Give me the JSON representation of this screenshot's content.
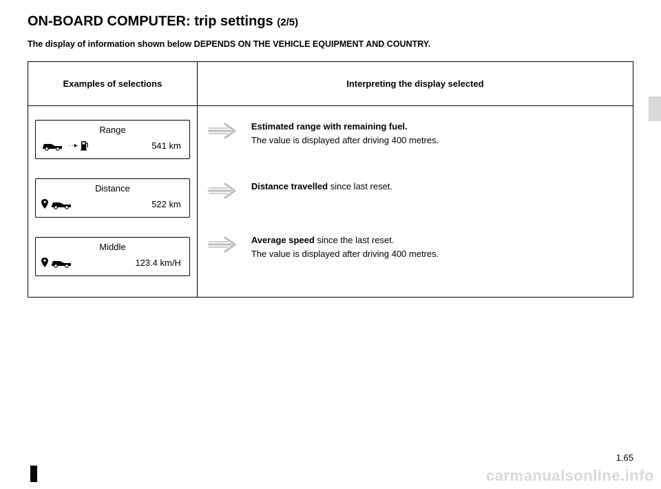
{
  "title": {
    "main": "ON-BOARD COMPUTER: trip settings",
    "suffix": "(2/5)"
  },
  "subtext": "The display of information shown below DEPENDS ON THE VEHICLE EQUIPMENT AND COUNTRY.",
  "headers": {
    "col1": "Examples of selections",
    "col2": "Interpreting the display selected"
  },
  "rows": [
    {
      "label": "Range",
      "value": "541 km",
      "interp_bold": "Estimated range with remaining fuel.",
      "interp_rest": "",
      "interp_line2": "The value is displayed after driving 400 metres.",
      "icon_type": "car_fuel"
    },
    {
      "label": "Distance",
      "value": "522 km",
      "interp_bold": "Distance travelled",
      "interp_rest": " since last reset.",
      "interp_line2": "",
      "icon_type": "pin_car"
    },
    {
      "label": "Middle",
      "value": "123.4 km/H",
      "interp_bold": "Average speed",
      "interp_rest": " since the last reset.",
      "interp_line2": "The value is displayed after driving 400 metres.",
      "icon_type": "pin_car"
    }
  ],
  "page_num": "1.65",
  "watermark": "carmanualsonline.info"
}
